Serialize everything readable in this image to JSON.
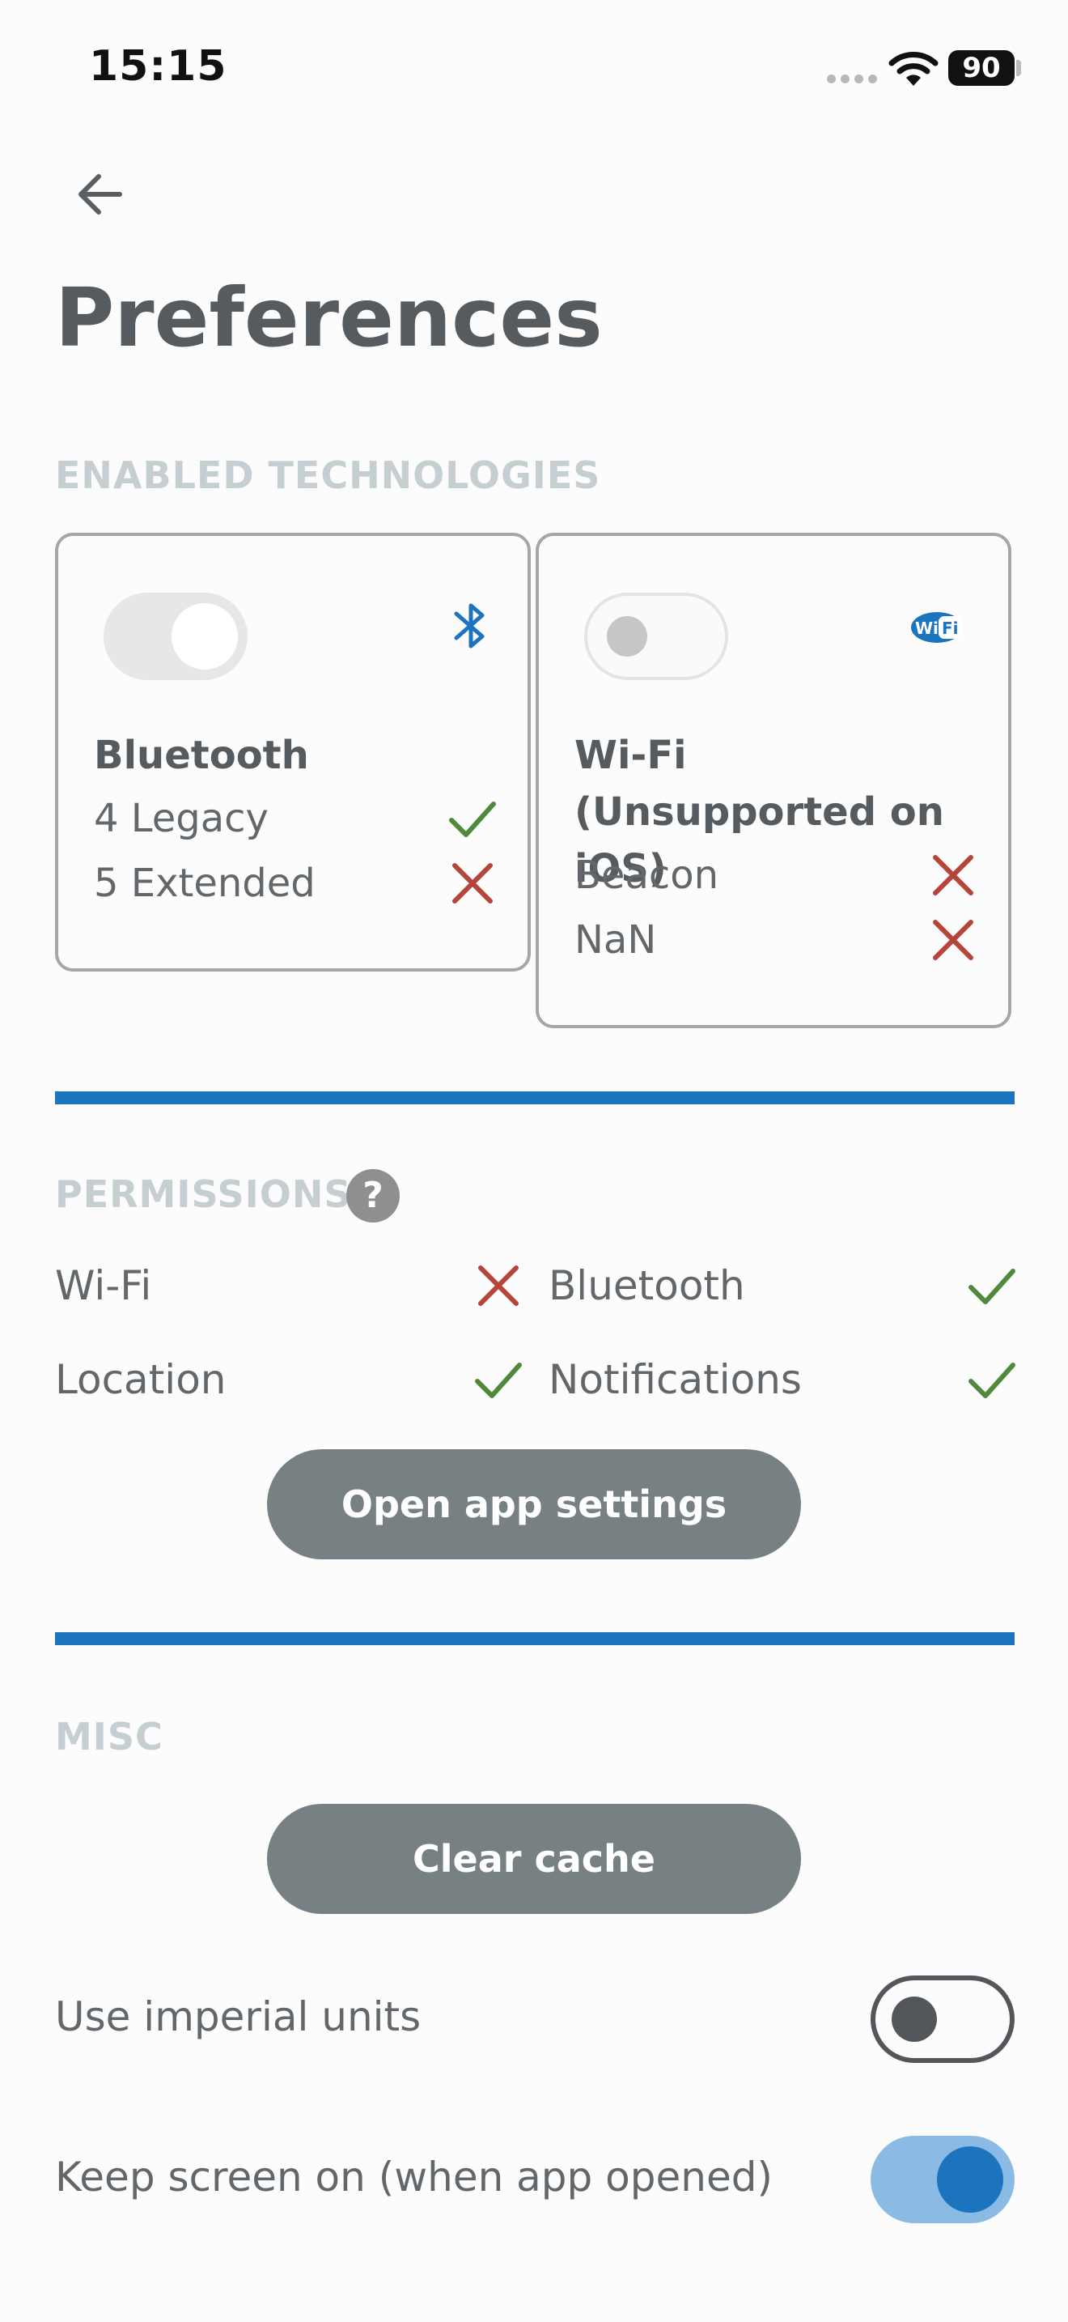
{
  "status_bar": {
    "time": "15:15",
    "battery": "90"
  },
  "header": {
    "title": "Preferences"
  },
  "enabled_technologies": {
    "header": "ENABLED TECHNOLOGIES",
    "bluetooth_card": {
      "title": "Bluetooth",
      "icon": "bluetooth-icon",
      "toggle_state": "off",
      "features": [
        {
          "label": "4 Legacy",
          "supported": true
        },
        {
          "label": "5 Extended",
          "supported": false
        }
      ]
    },
    "wifi_card": {
      "title": "Wi-Fi (Unsupported on iOS)",
      "icon": "wifi-logo-icon",
      "toggle_state": "disabled",
      "features": [
        {
          "label": "Beacon",
          "supported": false
        },
        {
          "label": "NaN",
          "supported": false
        }
      ]
    }
  },
  "permissions": {
    "header": "PERMISSIONS",
    "help_icon": "?",
    "items": [
      {
        "label": "Wi-Fi",
        "granted": false
      },
      {
        "label": "Bluetooth",
        "granted": true
      },
      {
        "label": "Location",
        "granted": true
      },
      {
        "label": "Notifications",
        "granted": true
      }
    ],
    "open_settings_label": "Open app settings"
  },
  "misc": {
    "header": "MISC",
    "clear_cache_label": "Clear cache",
    "settings": [
      {
        "label": "Use imperial units",
        "enabled": false
      },
      {
        "label": "Keep screen on (when app opened)",
        "enabled": true
      }
    ]
  },
  "colors": {
    "accent": "#1c74bf",
    "check": "#4f8a3c",
    "cross": "#b5443a",
    "section_header": "#c5ced0",
    "button": "#778183"
  }
}
